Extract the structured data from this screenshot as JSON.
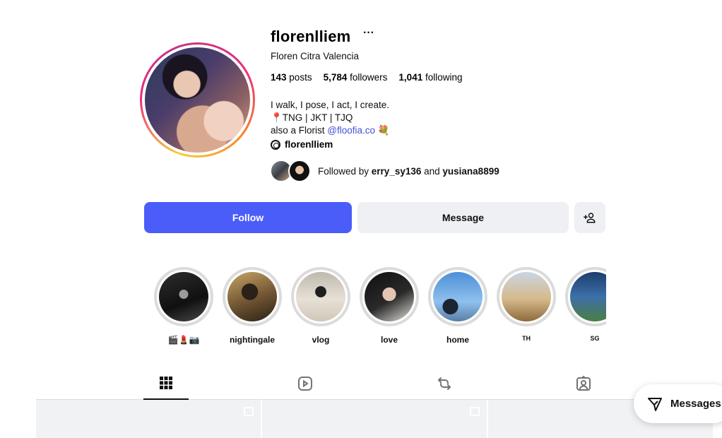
{
  "profile": {
    "username": "florenlliem",
    "more": "···",
    "full_name": "Floren Citra Valencia",
    "stats": {
      "posts_count": "143",
      "posts_label": "posts",
      "followers_count": "5,784",
      "followers_label": "followers",
      "following_count": "1,041",
      "following_label": "following"
    },
    "bio": {
      "line1": "I walk, I pose, I act, I create.",
      "line2": "📍TNG | JKT | TJQ",
      "line3_prefix": "also a Florist ",
      "line3_link": "@floofia.co",
      "line3_suffix": " 💐"
    },
    "threads_handle": "florenlliem",
    "followed_by": {
      "prefix": "Followed by ",
      "user1": "erry_sy136",
      "joiner": " and ",
      "user2": "yusiana8899"
    }
  },
  "actions": {
    "follow_label": "Follow",
    "message_label": "Message"
  },
  "highlights": [
    {
      "label": "🎬💄📷"
    },
    {
      "label": "nightingale"
    },
    {
      "label": "vlog"
    },
    {
      "label": "love"
    },
    {
      "label": "home"
    },
    {
      "label": "TH"
    },
    {
      "label": "SG"
    }
  ],
  "tabs": [
    "posts-grid-icon",
    "reels-icon",
    "reposts-icon",
    "tagged-icon"
  ],
  "messages_pill": {
    "label": "Messages"
  },
  "colors": {
    "accent": "#4a5df9",
    "link": "#3f51d9",
    "button_bg": "#eff0f4"
  }
}
